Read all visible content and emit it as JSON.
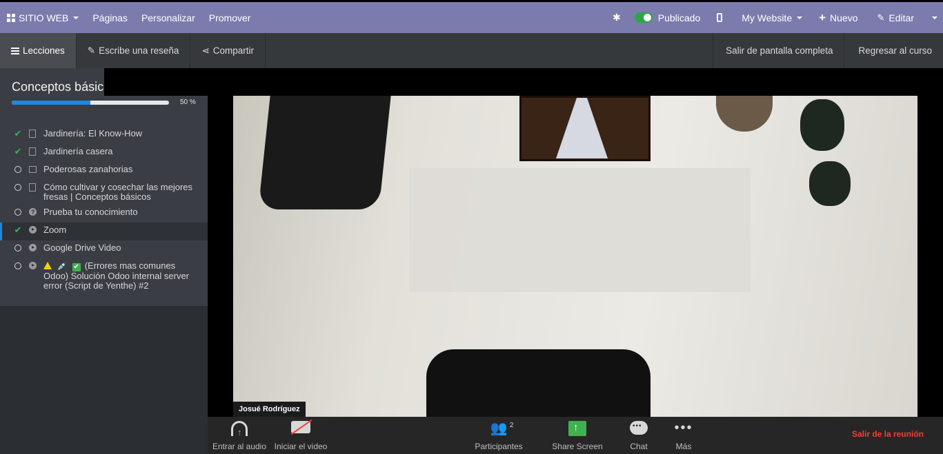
{
  "topbar": {
    "app_label": "SITIO WEB",
    "menus": [
      "Páginas",
      "Personalizar",
      "Promover"
    ],
    "published_label": "Publicado",
    "website_label": "My Website",
    "new_label": "Nuevo",
    "edit_label": "Editar",
    "color": "#7c7bad"
  },
  "navbar": {
    "lessons_label": "Lecciones",
    "review_label": "Escribe una reseña",
    "share_label": "Compartir",
    "exit_fullscreen_label": "Salir de pantalla completa",
    "back_label": "Regresar al curso"
  },
  "sidebar": {
    "course_title": "Conceptos básicos",
    "progress_percent": 50,
    "progress_label": "50 %",
    "lessons": [
      {
        "title": "Jardinería: El Know-How",
        "done": true,
        "type": "document"
      },
      {
        "title": "Jardinería casera",
        "done": true,
        "type": "document"
      },
      {
        "title": "Poderosas zanahorias",
        "done": false,
        "type": "image"
      },
      {
        "title": "Cómo cultivar y cosechar las mejores fresas | Conceptos básicos",
        "done": false,
        "type": "document"
      },
      {
        "title": "Prueba tu conocimiento",
        "done": false,
        "type": "quiz"
      },
      {
        "title": "Zoom",
        "done": true,
        "type": "video",
        "active": true
      },
      {
        "title": "Google Drive Video",
        "done": false,
        "type": "video"
      },
      {
        "title": "(Errores mas comunes Odoo) Solución Odoo internal server error (Script de Yenthe) #2",
        "done": false,
        "type": "video"
      }
    ]
  },
  "video": {
    "participant_name": "Josué Rodríguez"
  },
  "zoom_toolbar": {
    "audio_label": "Entrar al audio",
    "video_label": "Iniciar el video",
    "participants_label": "Participantes",
    "participants_count": "2",
    "share_label": "Share Screen",
    "chat_label": "Chat",
    "more_label": "Más",
    "leave_label": "Salir de la reunión",
    "leave_color": "#ff3b30",
    "share_color": "#3fb24f"
  }
}
